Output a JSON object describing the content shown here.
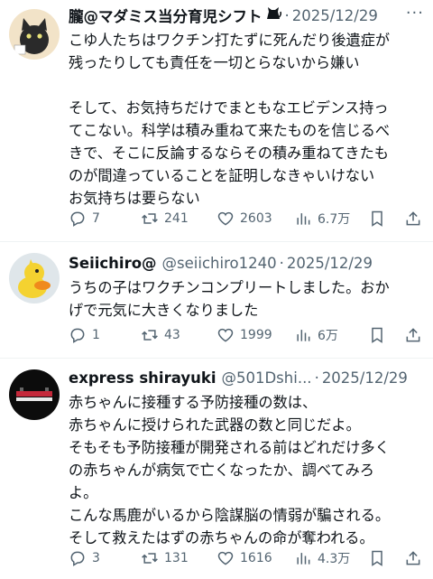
{
  "tweets": [
    {
      "name": "朧@マダミス当分育児シフト",
      "handle": "",
      "date": "2025/12/29",
      "text": "こゆ人たちはワクチン打たずに死んだり後遺症が\n残ったりしても責任を一切とらないから嫌い\n\nそして、お気持ちだけでまともなエビデンス持っ\nてこない。科学は積み重ねて来たものを信じるべ\nきで、そこに反論するならその積み重ねてきたも\nのが間違っていることを証明しなきゃいけない\nお気持ちは要らない",
      "replies": "7",
      "reposts": "241",
      "likes": "2603",
      "views": "6.7万"
    },
    {
      "name": "Seiichiro@",
      "handle": "@seiichiro1240",
      "date": "2025/12/29",
      "text": "うちの子はワクチンコンプリートしました。おか\nげで元気に大きくなりました",
      "replies": "1",
      "reposts": "43",
      "likes": "1999",
      "views": "6万"
    },
    {
      "name": "express shirayuki",
      "handle": "@501Dshi...",
      "date": "2025/12/29",
      "text": "赤ちゃんに接種する予防接種の数は、\n赤ちゃんに授けられた武器の数と同じだよ。\nそもそも予防接種が開発される前はどれだけ多く\nの赤ちゃんが病気で亡くなったか、調べてみろ\nよ。\nこんな馬鹿がいるから陰謀脳の情弱が騙される。\nそして救えたはずの赤ちゃんの命が奪われる。",
      "replies": "3",
      "reposts": "131",
      "likes": "1616",
      "views": "4.3万"
    }
  ],
  "ui": {
    "separator": "·",
    "more": "···"
  }
}
